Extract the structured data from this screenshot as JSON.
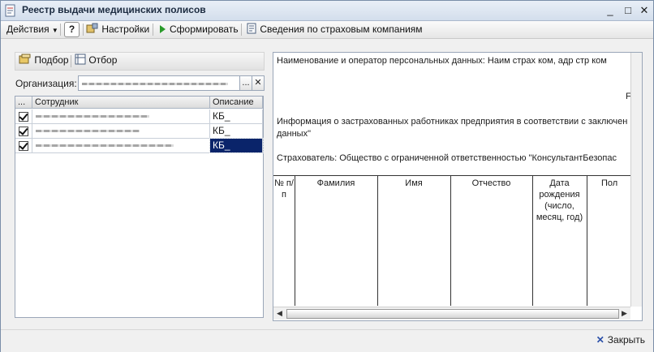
{
  "window": {
    "title": "Реестр выдачи медицинских полисов",
    "controls": {
      "minimize": "_",
      "maximize": "□",
      "close": "✕"
    }
  },
  "toolbar": {
    "actions_label": "Действия",
    "help_label": "?",
    "settings_label": "Настройки",
    "generate_label": "Сформировать",
    "insurance_info_label": "Сведения по страховым компаниям"
  },
  "left": {
    "select_label": "Подбор",
    "filter_label": "Отбор",
    "org_label": "Организация:",
    "org_button_label": "...",
    "org_clear_label": "✕",
    "table": {
      "columns": [
        "...",
        "Сотрудник",
        "Описание"
      ],
      "rows": [
        {
          "checked": true,
          "description": "КБ_"
        },
        {
          "checked": true,
          "description": "КБ_"
        },
        {
          "checked": true,
          "description": "КБ_"
        }
      ]
    }
  },
  "report": {
    "line1": "Наименование и оператор персональных данных: Наим страх ком, адр стр ком",
    "marker": "F",
    "line2": "Информация о застрахованных работниках предприятия в соответствии с заключен",
    "line3": "данных\"",
    "line4": "Страхователь: Общество с ограниченной ответственностью \"КонсультантБезопас",
    "columns": [
      "№ п/п",
      "Фамилия",
      "Имя",
      "Отчество",
      "Дата рождения (число, месяц, год)",
      "Пол"
    ]
  },
  "footer": {
    "close_label": "Закрыть"
  },
  "colors": {
    "selection": "#0a246a",
    "title_gradient_top": "#e9eff7",
    "generate_icon": "#2a9a2a"
  }
}
